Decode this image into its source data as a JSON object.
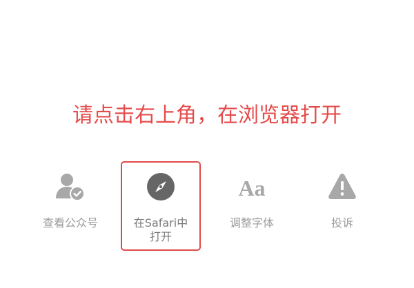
{
  "instruction": {
    "text": "请点击右上角，在浏览器打开",
    "color": "#e64b4b"
  },
  "menu": {
    "items": [
      {
        "label": "查看公众号",
        "icon": "user-check-icon",
        "highlighted": false
      },
      {
        "label": "在Safari中打开",
        "label_line1": "在Safari中",
        "label_line2": "打开",
        "icon": "compass-icon",
        "highlighted": true
      },
      {
        "label": "调整字体",
        "icon": "font-size-icon",
        "icon_text": "Aa",
        "highlighted": false
      },
      {
        "label": "投诉",
        "icon": "warning-icon",
        "highlighted": false
      }
    ],
    "highlight_color": "#e04a4a",
    "icon_color": "#a8a8a8"
  }
}
